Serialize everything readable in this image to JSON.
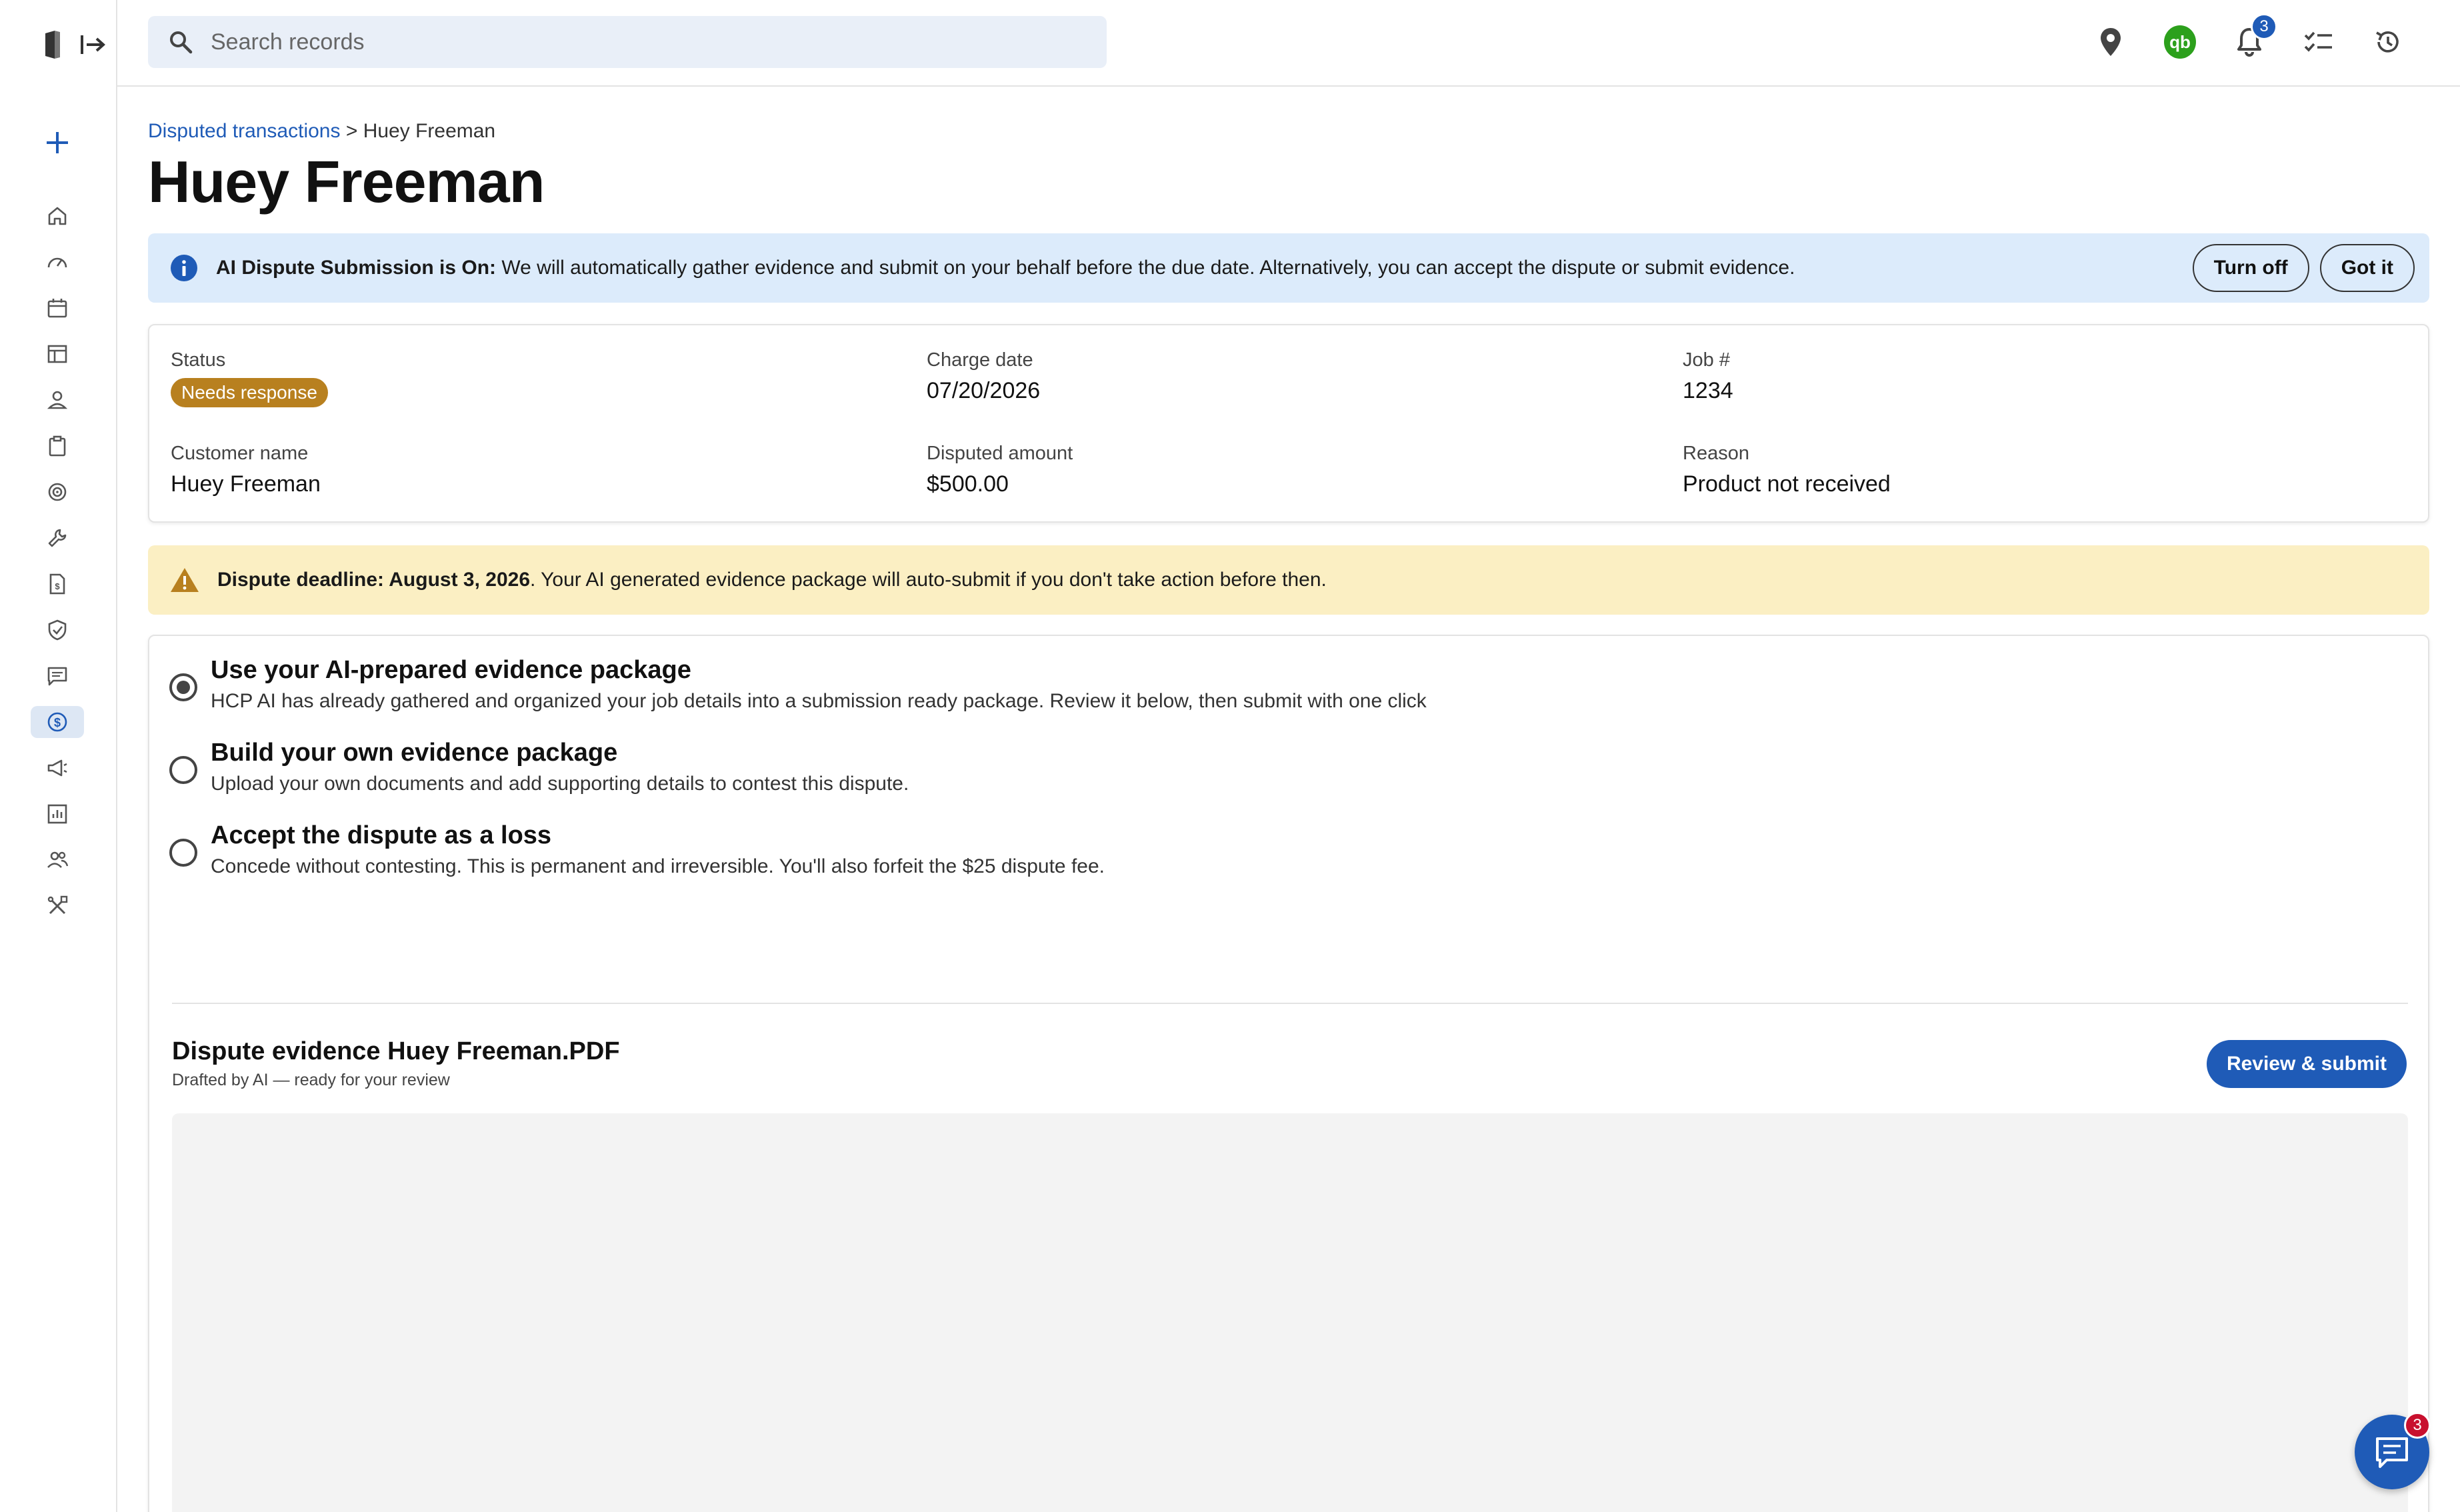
{
  "search": {
    "placeholder": "Search records"
  },
  "topbar": {
    "quickbooks_label": "qb",
    "notifications_count": "3"
  },
  "breadcrumb": {
    "parent": "Disputed transactions",
    "separator": " > ",
    "current": "Huey Freeman"
  },
  "page": {
    "title": "Huey Freeman"
  },
  "info_banner": {
    "bold": "AI Dispute Submission is On:",
    "text": " We will automatically gather evidence and submit on your behalf before the due date. Alternatively, you can accept the dispute or submit evidence.",
    "turn_off": "Turn off",
    "got_it": "Got it"
  },
  "details": {
    "status_label": "Status",
    "status_value": "Needs response",
    "charge_date_label": "Charge date",
    "charge_date_value": "07/20/2026",
    "job_label": "Job #",
    "job_value": "1234",
    "customer_label": "Customer name",
    "customer_value": "Huey Freeman",
    "amount_label": "Disputed amount",
    "amount_value": "$500.00",
    "reason_label": "Reason",
    "reason_value": "Product not received"
  },
  "warning": {
    "bold": "Dispute deadline: August 3, 2026",
    "text": ". Your AI generated evidence package will auto-submit if you don't take action before then."
  },
  "options": [
    {
      "title": "Use your AI-prepared evidence package",
      "desc": "HCP AI has already gathered and organized your job details into a submission ready package. Review it below, then submit with one click",
      "selected": true
    },
    {
      "title": "Build your own evidence package",
      "desc": "Upload your own documents and add supporting details to contest this dispute.",
      "selected": false
    },
    {
      "title": "Accept the dispute as a loss",
      "desc": "Concede without contesting. This is permanent and irreversible. You'll also forfeit the $25 dispute fee.",
      "selected": false
    }
  ],
  "document": {
    "title": "Dispute evidence Huey Freeman.PDF",
    "subtitle": "Drafted by AI — ready for your review",
    "submit_label": "Review & submit"
  },
  "chat": {
    "badge_count": "3"
  },
  "colors": {
    "accent": "#1f5bb7",
    "info_bg": "#dcebfb",
    "warning_bg": "#fbefc3",
    "status_badge": "#b8801f",
    "quickbooks": "#2ca01c"
  }
}
